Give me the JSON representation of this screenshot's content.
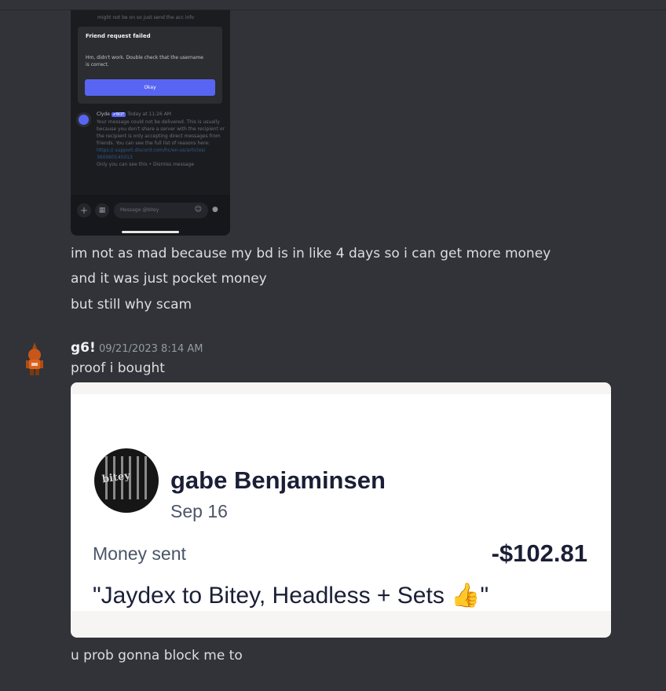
{
  "screenshot": {
    "top_text": "might not be on so just send the acc info",
    "dialog": {
      "title": "Friend request failed",
      "body": "Hm, didn't work. Double check that the username is correct.",
      "button": "Okay"
    },
    "clyde": {
      "name": "Clyde",
      "badge": "✔BOT",
      "time": "Today at 11:26 AM",
      "message": "Your message could not be delivered. This is usually because you don't share a server with the recipient or the recipient is only accepting direct messages from friends. You can see the full list of reasons here:",
      "link": "https:// support.discord.com/hc/en-us/articles/ 360060145013",
      "footnote": "Only you can see this • Dismiss message"
    },
    "composer_placeholder": "Message @bitey"
  },
  "messages_before": [
    "im not as mad because my bd is in like 4 days so i can get more money",
    "and it was just pocket money",
    "but still why scam"
  ],
  "author": {
    "name": "g6!",
    "timestamp": "09/21/2023 8:14 AM"
  },
  "message_proof": "proof i bought",
  "payment": {
    "avatar_text": "bitey",
    "payee": "gabe Benjaminsen",
    "date": "Sep 16",
    "status_label": "Money sent",
    "amount": "-$102.81",
    "memo": "\"Jaydex to Bitey, Headless + Sets 👍\""
  },
  "message_after": "u prob gonna block me to",
  "icons": {
    "plus": "plus-icon",
    "gift": "gift-icon",
    "emoji": "emoji-icon",
    "mic": "mic-icon"
  }
}
